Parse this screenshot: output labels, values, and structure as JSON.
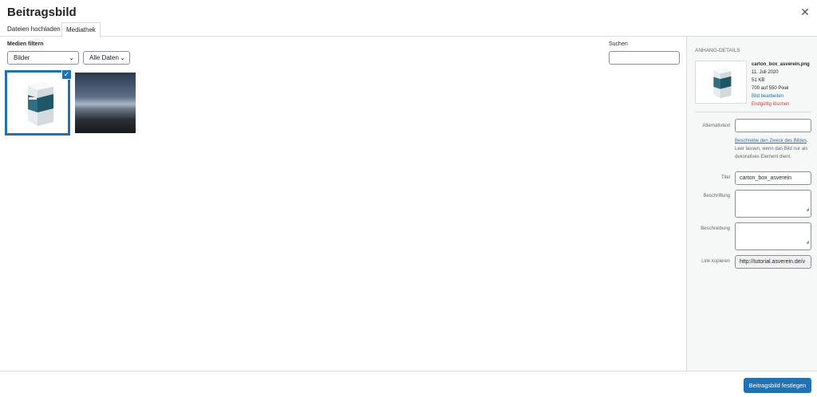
{
  "modal": {
    "title": "Beitragsbild",
    "close_icon": "close-icon"
  },
  "tabs": [
    {
      "label": "Dateien hochladen"
    },
    {
      "label": "Mediathek"
    }
  ],
  "toolbar": {
    "filter_label": "Medien filtern",
    "type_select": "Bilder",
    "date_select": "Alle Daten",
    "search_label": "Suchen",
    "search_value": ""
  },
  "media": [
    {
      "name": "carton-box-image",
      "selected": true
    },
    {
      "name": "mountain-image",
      "selected": false
    }
  ],
  "sidebar": {
    "heading": "Anhang-Details",
    "filename": "carton_box_asverein.png",
    "date": "11. Juli 2020",
    "size": "51 KB",
    "dimensions": "700 auf 550 Pixel",
    "edit_link": "Bild bearbeiten",
    "delete_link": "Endgültig löschen",
    "alt_label": "Alternativtext",
    "alt_value": "",
    "help_link": "Beschreibe den Zweck des Bildes",
    "help_text": ". Leer lassen, wenn das Bild nur als dekoratives Element dient.",
    "title_label": "Titel",
    "title_value": "carton_box_asverein",
    "caption_label": "Beschriftung",
    "description_label": "Beschreibung",
    "link_label": "Link kopieren",
    "link_value": "http://tutorial.asverein.de/v"
  },
  "footer": {
    "primary_button": "Beitragsbild festlegen"
  },
  "colors": {
    "accent": "#2271b1",
    "danger": "#d63638"
  }
}
